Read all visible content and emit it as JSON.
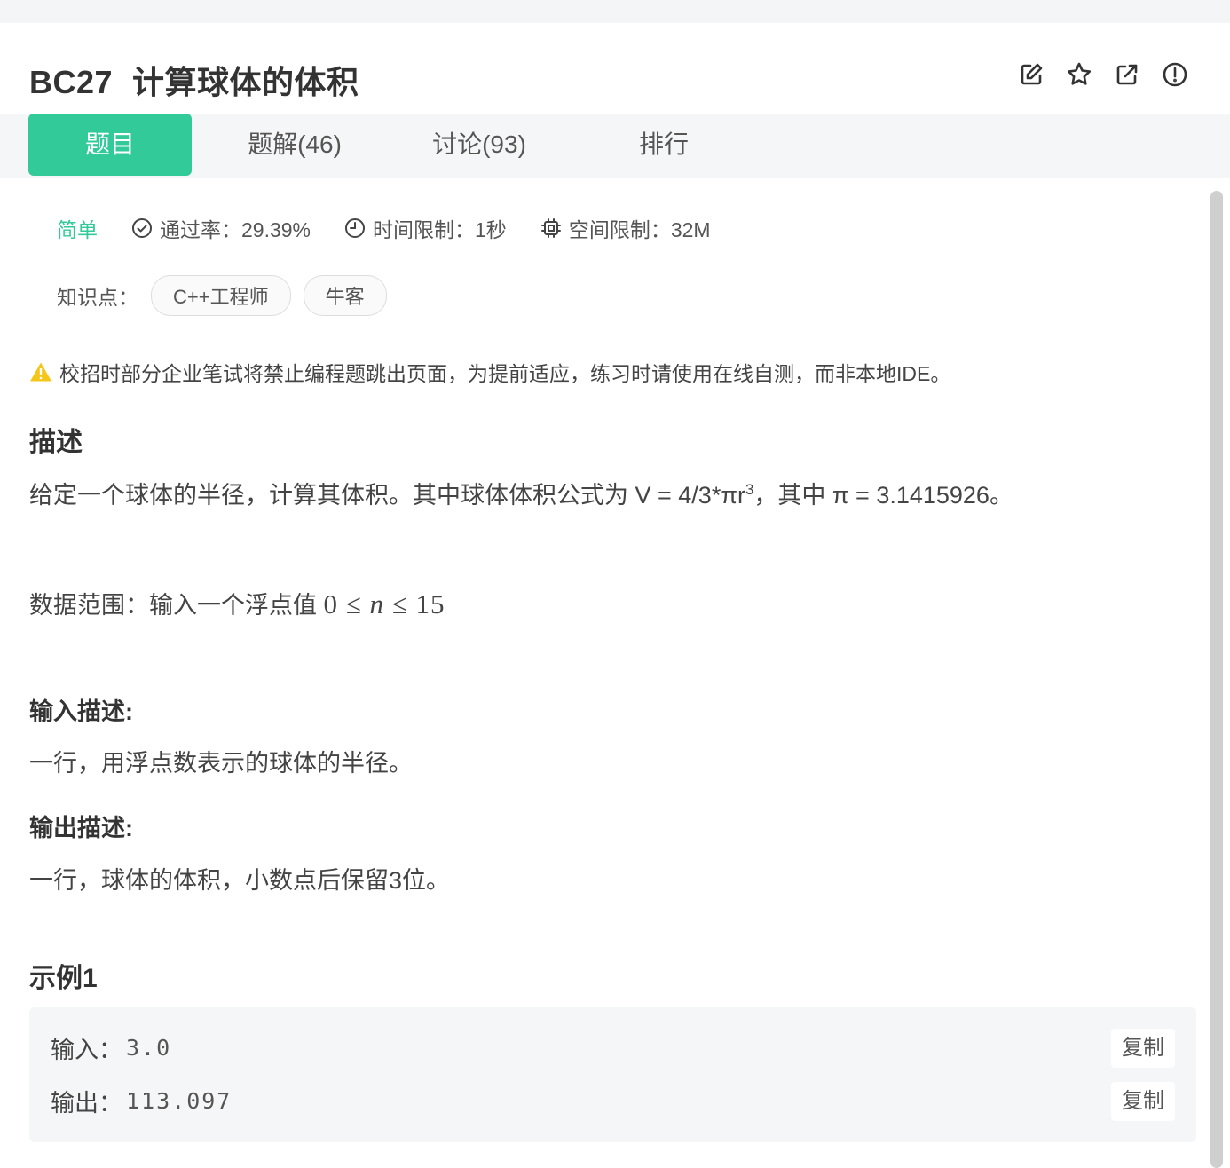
{
  "header": {
    "code": "BC27",
    "title": "计算球体的体积",
    "icons": [
      "edit-icon",
      "star-icon",
      "external-link-icon",
      "report-icon"
    ]
  },
  "tabs": [
    {
      "label": "题目",
      "active": true
    },
    {
      "label": "题解(46)",
      "active": false
    },
    {
      "label": "讨论(93)",
      "active": false
    },
    {
      "label": "排行",
      "active": false
    }
  ],
  "meta": {
    "difficulty": "简单",
    "pass_rate": "通过率：29.39%",
    "time_limit": "时间限制：1秒",
    "space_limit": "空间限制：32M"
  },
  "knowledge": {
    "label": "知识点：",
    "tags": [
      "C++工程师",
      "牛客"
    ]
  },
  "warning": "校招时部分企业笔试将禁止编程题跳出页面，为提前适应，练习时请使用在线自测，而非本地IDE。",
  "description": {
    "heading": "描述",
    "text_before": "给定一个球体的半径，计算其体积。其中球体体积公式为 V = 4/3*πr",
    "superscript": "3",
    "text_after": "，其中 π = 3.1415926。",
    "range_label": "数据范围：输入一个浮点值 ",
    "range_math_left": "0 ≤ ",
    "range_math_var": "n",
    "range_math_right": " ≤ 15"
  },
  "input_desc": {
    "heading": "输入描述:",
    "text": "一行，用浮点数表示的球体的半径。"
  },
  "output_desc": {
    "heading": "输出描述:",
    "text": "一行，球体的体积，小数点后保留3位。"
  },
  "example": {
    "heading": "示例1",
    "input_label": "输入：",
    "input_value": "3.0",
    "output_label": "输出：",
    "output_value": "113.097",
    "copy_label": "复制"
  },
  "colors": {
    "accent": "#32ca99",
    "warning": "#f5c518"
  }
}
